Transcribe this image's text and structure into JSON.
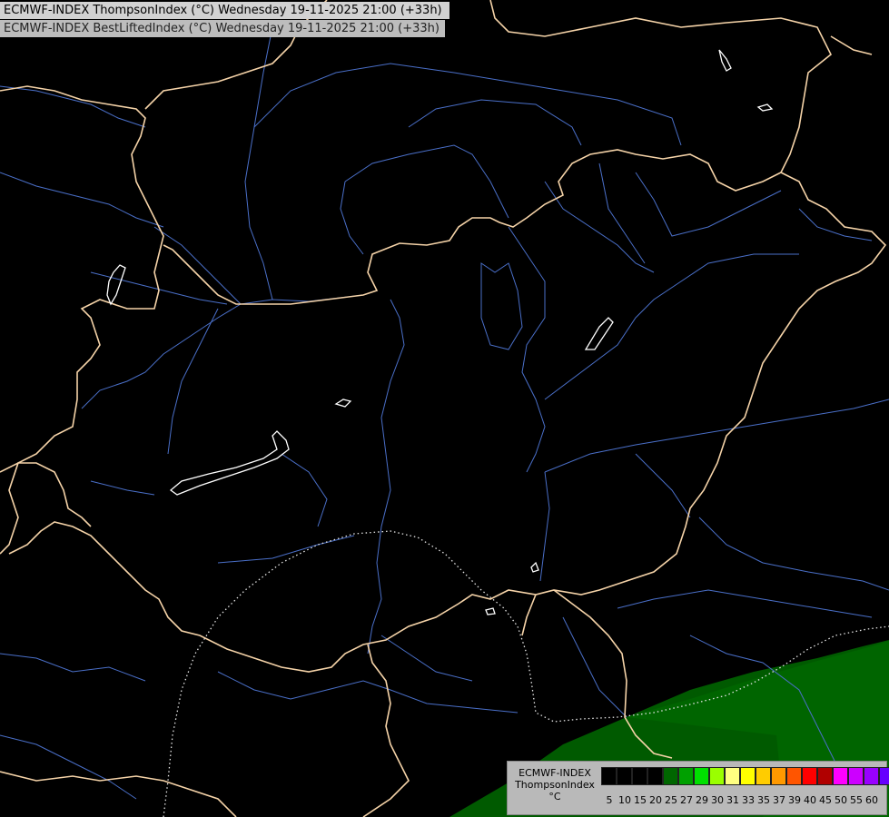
{
  "titles": {
    "line1": "ECMWF-INDEX ThompsonIndex (°C) Wednesday 19-11-2025 21:00 (+33h)",
    "line2": "ECMWF-INDEX BestLiftedIndex (°C) Wednesday 19-11-2025 21:00 (+33h)"
  },
  "legend": {
    "title_line1": "ECMWF-INDEX",
    "title_line2": "ThompsonIndex",
    "unit": "°C",
    "colors": [
      "#000000",
      "#000000",
      "#000000",
      "#000000",
      "#006600",
      "#00a000",
      "#00e000",
      "#9aff00",
      "#ffff80",
      "#ffff00",
      "#ffcc00",
      "#ff9900",
      "#ff5500",
      "#ff0000",
      "#b00000",
      "#ff00ff",
      "#cc00ff",
      "#9900ff",
      "#6600ff",
      "#0000ff"
    ],
    "ticks": [
      "5",
      "10",
      "15",
      "20",
      "25",
      "27",
      "29",
      "30",
      "31",
      "33",
      "35",
      "37",
      "39",
      "40",
      "45",
      "50",
      "55",
      "60"
    ]
  },
  "colors": {
    "border": "#f5d3a8",
    "river": "#4a6fc8",
    "lake": "#ffffff",
    "contour": "#e6e6e6",
    "field_dark": "#005a00",
    "field_mid": "#006e00"
  }
}
